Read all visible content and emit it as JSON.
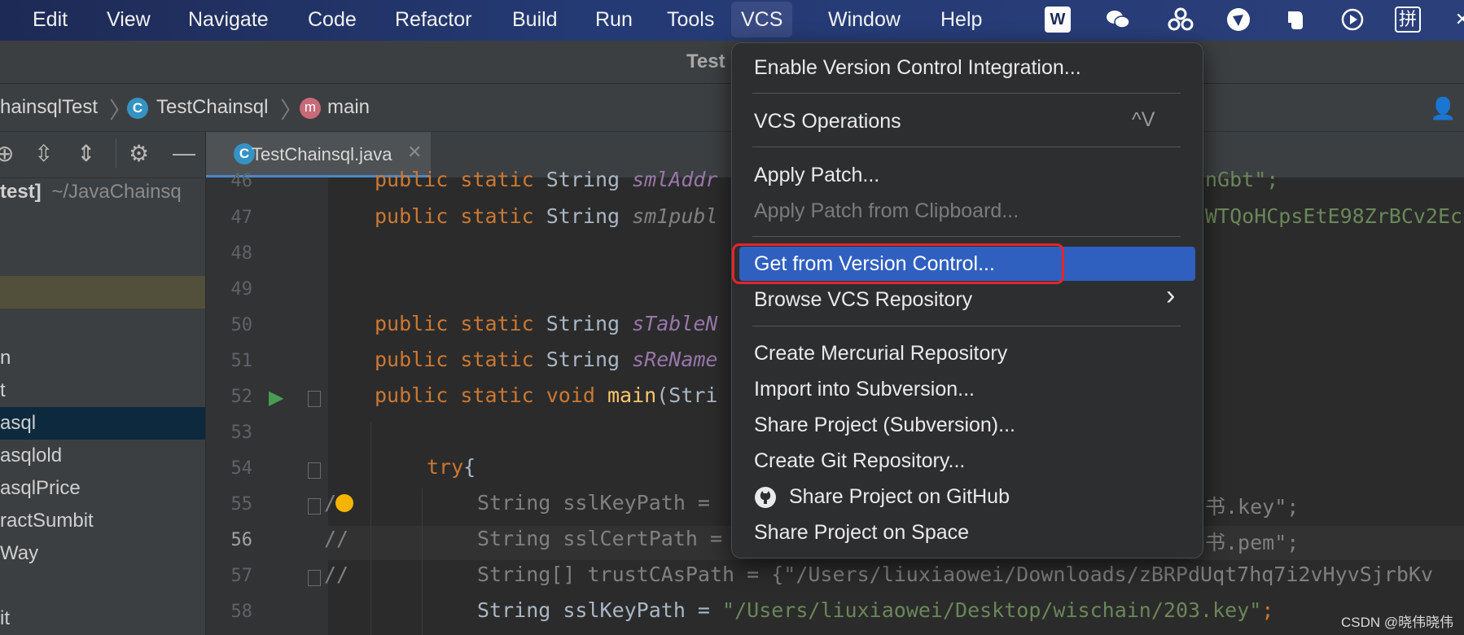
{
  "menubar": {
    "items": [
      "Edit",
      "View",
      "Navigate",
      "Code",
      "Refactor",
      "Build",
      "Run",
      "Tools",
      "VCS",
      "Window",
      "Help"
    ],
    "active": "VCS",
    "tray": [
      "wps-icon",
      "wechat-icon",
      "cloud-sync-icon",
      "bird-icon",
      "evernote-icon",
      "play-icon",
      "pinyin-icon"
    ]
  },
  "ide": {
    "title_partial": "Test"
  },
  "breadcrumb": {
    "items": [
      "hainsqlTest",
      "TestChainsql",
      "main"
    ],
    "class_icon": "C",
    "method_icon": "m"
  },
  "project": {
    "header_partial": "test]",
    "path": "~/JavaChainsq",
    "tree": [
      "n",
      "t",
      "asql",
      "asqlold",
      "asqlPrice",
      "ractSumbit",
      "Way",
      "it"
    ]
  },
  "tabs": [
    {
      "label": "TestChainsql.java",
      "icon": "C"
    }
  ],
  "editor": {
    "line_numbers": [
      "46",
      "47",
      "48",
      "49",
      "50",
      "51",
      "52",
      "53",
      "54",
      "55",
      "56",
      "57",
      "58"
    ],
    "lines": {
      "l46": {
        "kw": "public static",
        "ty": "String",
        "fld": "smlAddr",
        "tail": "nGbt\";"
      },
      "l47": {
        "kw": "public static",
        "ty": "String",
        "fld": "sm1publ",
        "tail": "WTQoHCpsEtE98ZrBCv2Ec"
      },
      "l50": {
        "kw": "public static",
        "ty": "String",
        "fld": "sTableN"
      },
      "l51": {
        "kw": "public static",
        "ty": "String",
        "fld": "sReName"
      },
      "l52": {
        "kw": "public static void",
        "fn": "main",
        "rest": "(Stri"
      },
      "l54": {
        "kw": "try",
        "rest": "{"
      },
      "l55": {
        "com": "/",
        "code": "String sslKeyPath =",
        "tail": "书.key\";"
      },
      "l56": {
        "com": "//",
        "code": "String sslCertPath =",
        "tail": "书.pem\";"
      },
      "l57": {
        "com": "//",
        "code": "String[] trustCAsPath = {\"/Users/liuxiaowei/Downloads/zBRPdUqt7hq7i2vHyvSjrbKv"
      },
      "l58": {
        "code": "String sslKeyPath =",
        "str": "\"/Users/liuxiaowei/Desktop/wischain/203.key\"",
        "end": ";"
      }
    }
  },
  "vcs_menu": {
    "items": [
      {
        "label": "Enable Version Control Integration...",
        "enabled": true
      },
      {
        "label": "VCS Operations",
        "enabled": true,
        "shortcut": "^V"
      },
      {
        "label": "Apply Patch...",
        "enabled": true
      },
      {
        "label": "Apply Patch from Clipboard...",
        "enabled": false
      },
      {
        "label": "Get from Version Control...",
        "enabled": true,
        "highlighted": true
      },
      {
        "label": "Browse VCS Repository",
        "enabled": true,
        "submenu": "›"
      },
      {
        "label": "Create Mercurial Repository",
        "enabled": true
      },
      {
        "label": "Import into Subversion...",
        "enabled": true
      },
      {
        "label": "Share Project (Subversion)...",
        "enabled": true
      },
      {
        "label": "Create Git Repository...",
        "enabled": true
      },
      {
        "label": "Share Project on GitHub",
        "enabled": true,
        "icon": "github-icon"
      },
      {
        "label": "Share Project on Space",
        "enabled": true
      }
    ]
  },
  "watermark": "CSDN @晓伟晓伟",
  "colors": {
    "highlight": "#2f5fbf",
    "annotation": "#e4262b",
    "menubar": "#243a74"
  }
}
